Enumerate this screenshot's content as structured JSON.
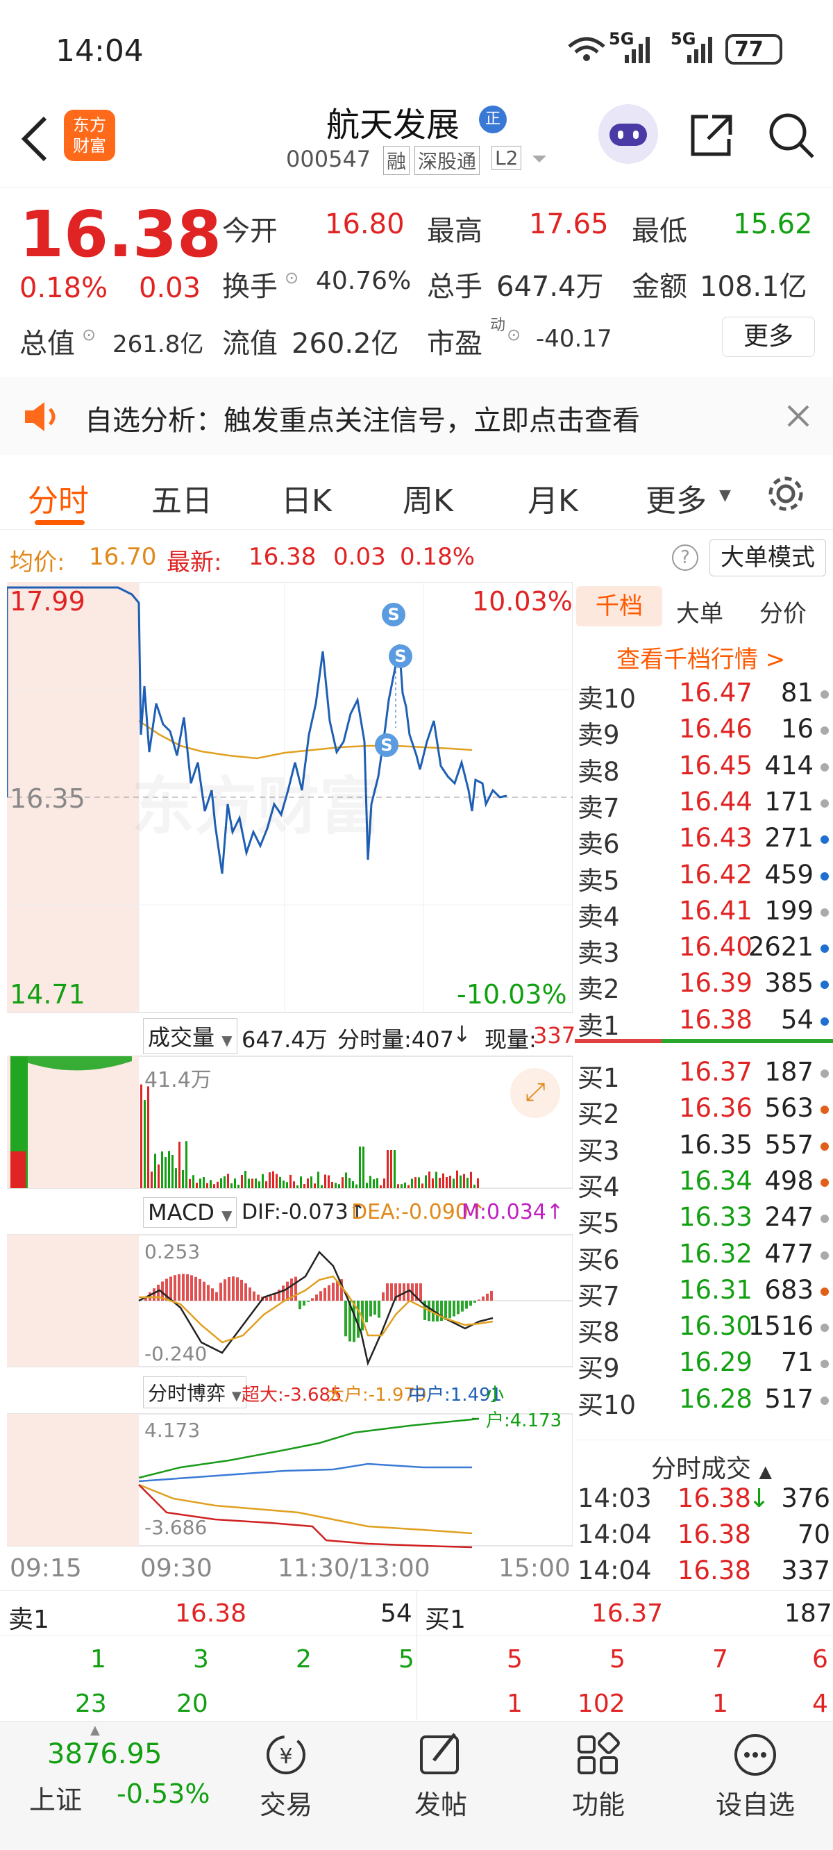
{
  "status": {
    "time": "14:04",
    "net1": "5G",
    "net2": "5G",
    "battery": "77"
  },
  "nav": {
    "back_icon": "back-arrow-icon",
    "logo_text": "东方\n财富",
    "stock_name": "航天发展",
    "badge": "正",
    "code": "000547",
    "tags": [
      "融",
      "深股通",
      "L2"
    ]
  },
  "quote": {
    "price": "16.38",
    "pct": "0.18%",
    "chg": "0.03",
    "open_label": "今开",
    "open": "16.80",
    "high_label": "最高",
    "high": "17.65",
    "low_label": "最低",
    "low": "15.62",
    "turnover_label": "换手",
    "turnover": "40.76%",
    "volume_label": "总手",
    "volume": "647.4万",
    "amount_label": "金额",
    "amount": "108.1亿",
    "mktcap_label": "总值",
    "mktcap": "261.8亿",
    "float_label": "流值",
    "float": "260.2亿",
    "pe_label": "市盈",
    "pe_sup": "动",
    "pe": "-40.17",
    "more": "更多"
  },
  "banner": {
    "text": "自选分析：触发重点关注信号，立即点击查看"
  },
  "tabs": [
    "分时",
    "五日",
    "日K",
    "周K",
    "月K",
    "更多"
  ],
  "info": {
    "avg_label": "均价:",
    "avg": "16.70",
    "latest_label": "最新:",
    "latest": "16.38",
    "chg": "0.03",
    "pct": "0.18%",
    "mode_btn": "大单模式"
  },
  "chart": {
    "ymax": "17.99",
    "ymin": "14.71",
    "mid": "16.35",
    "pmax": "10.03%",
    "pmin": "-10.03%",
    "vol_sel": "成交量",
    "vol_total": "647.4万",
    "vol_tick": "分时量:407",
    "vol_now_label": "现量:",
    "vol_now": "337",
    "vol_max": "41.4万",
    "macd_sel": "MACD",
    "dif": "DIF:-0.073",
    "dea": "DEA:-0.090",
    "m": "M:0.034",
    "macd_top": "0.253",
    "macd_bot": "-0.240",
    "bo_sel": "分时博弈",
    "bo_super": "超大:-3.685",
    "bo_big": "大户:-1.979",
    "bo_mid": "中户:1.491",
    "bo_small": "小户:4.173",
    "bo_top": "4.173",
    "bo_bot": "-3.686",
    "times": [
      "09:15",
      "09:30",
      "11:30/13:00",
      "15:00"
    ],
    "watermark": "东方财富"
  },
  "book": {
    "tabs": [
      "千档",
      "大单",
      "分价"
    ],
    "link": "查看千档行情 >",
    "asks": [
      [
        "卖10",
        "16.47",
        "81"
      ],
      [
        "卖9",
        "16.46",
        "16"
      ],
      [
        "卖8",
        "16.45",
        "414"
      ],
      [
        "卖7",
        "16.44",
        "171"
      ],
      [
        "卖6",
        "16.43",
        "271"
      ],
      [
        "卖5",
        "16.42",
        "459"
      ],
      [
        "卖4",
        "16.41",
        "199"
      ],
      [
        "卖3",
        "16.40",
        "2621"
      ],
      [
        "卖2",
        "16.39",
        "385"
      ],
      [
        "卖1",
        "16.38",
        "54"
      ]
    ],
    "bids": [
      [
        "买1",
        "16.37",
        "187"
      ],
      [
        "买2",
        "16.36",
        "563"
      ],
      [
        "买3",
        "16.35",
        "557"
      ],
      [
        "买4",
        "16.34",
        "498"
      ],
      [
        "买5",
        "16.33",
        "247"
      ],
      [
        "买6",
        "16.32",
        "477"
      ],
      [
        "买7",
        "16.31",
        "683"
      ],
      [
        "买8",
        "16.30",
        "1516"
      ],
      [
        "买9",
        "16.29",
        "71"
      ],
      [
        "买10",
        "16.28",
        "517"
      ]
    ],
    "trades_title": "分时成交",
    "trades": [
      [
        "14:03",
        "16.38",
        "376"
      ],
      [
        "14:04",
        "16.38",
        "70"
      ],
      [
        "14:04",
        "16.38",
        "337"
      ]
    ]
  },
  "bottomq": {
    "ask_label": "卖1",
    "ask_px": "16.38",
    "ask_qty": "54",
    "bid_label": "买1",
    "bid_px": "16.37",
    "bid_qty": "187",
    "ask_q1": [
      "1",
      "3",
      "2",
      "5"
    ],
    "ask_q2": [
      "23",
      "20"
    ],
    "bid_q1": [
      "5",
      "5",
      "7",
      "6"
    ],
    "bid_q2": [
      "1",
      "102",
      "1",
      "4"
    ]
  },
  "bottomnav": {
    "index_value": "3876.95",
    "index_name": "上证",
    "index_pct": "-0.53%",
    "items": [
      "交易",
      "发帖",
      "功能",
      "设自选"
    ]
  }
}
